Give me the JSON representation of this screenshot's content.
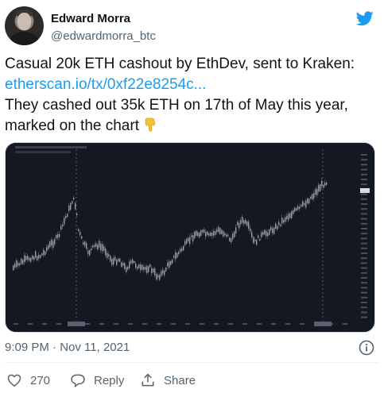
{
  "author": {
    "name": "Edward Morra",
    "handle": "@edwardmorra_btc"
  },
  "tweet": {
    "line1": "Casual 20k ETH cashout by EthDev, sent to Kraken:",
    "link": "etherscan.io/tx/0xf22e8254c...",
    "line3": "They cashed out 35k ETH on 17th of May this year,",
    "line4": "marked on the chart"
  },
  "meta": {
    "timestamp": "9:09 PM · Nov 11, 2021"
  },
  "actions": {
    "like_count": "270",
    "reply_label": "Reply",
    "share_label": "Share"
  },
  "colors": {
    "link": "#1d9bf0",
    "chart_bg": "#141822",
    "candle": "#8c8f96"
  },
  "icons": [
    "twitter-bird-icon",
    "point-down-emoji-icon",
    "info-icon",
    "heart-icon",
    "reply-icon",
    "share-icon"
  ]
}
